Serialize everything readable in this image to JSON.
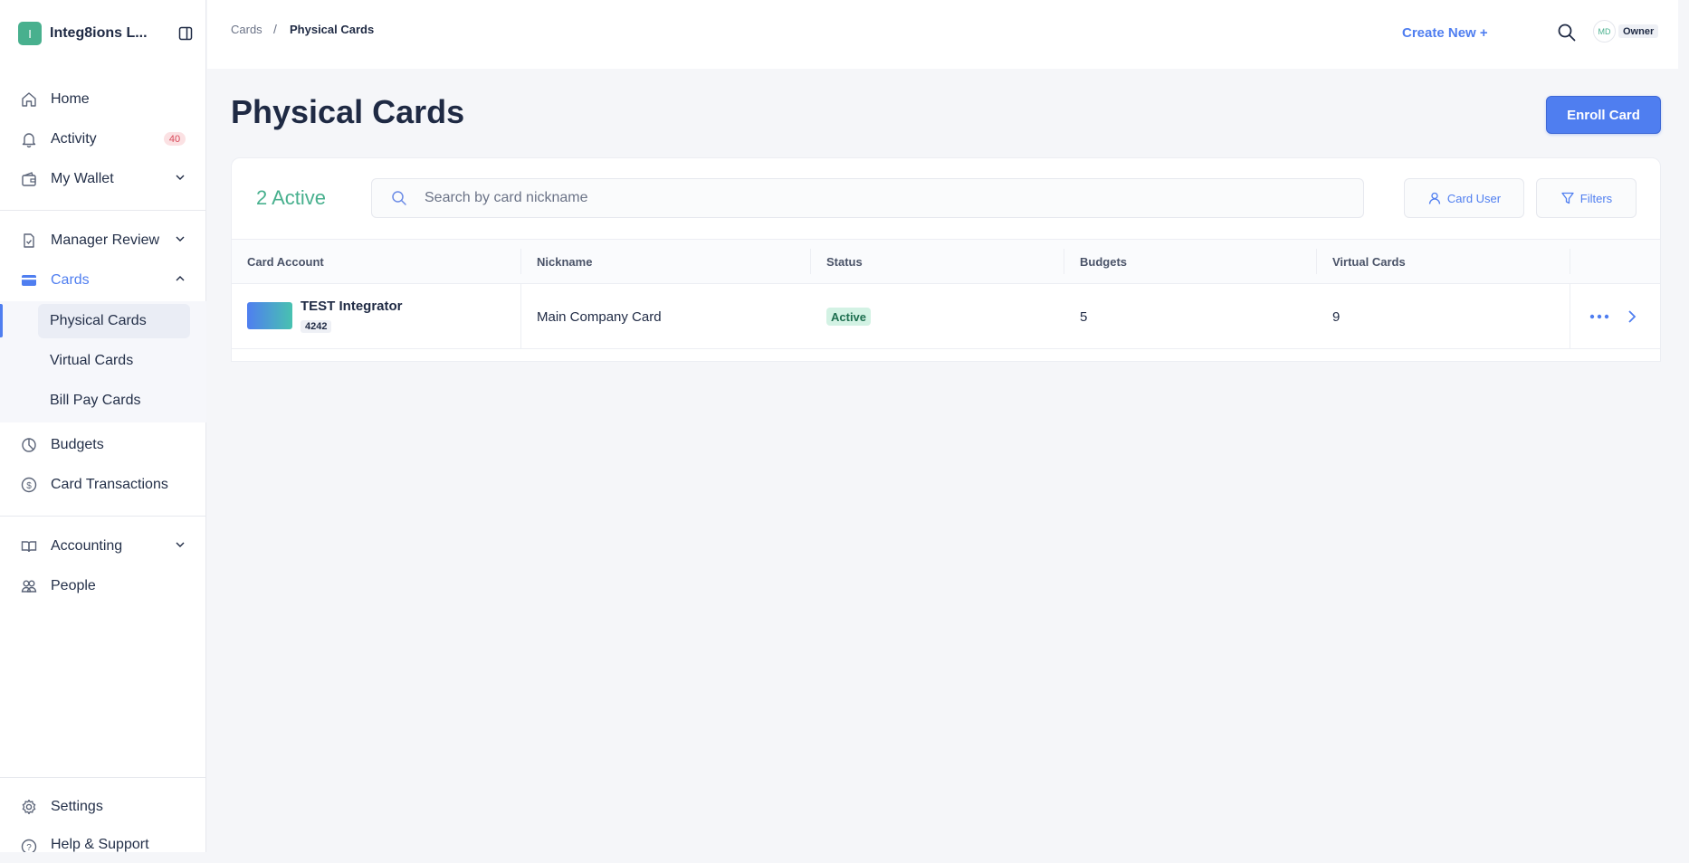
{
  "org": {
    "initial": "I",
    "name": "Integ8ions L..."
  },
  "nav": {
    "home": "Home",
    "activity": "Activity",
    "activity_badge": "40",
    "my_wallet": "My Wallet",
    "manager_review": "Manager Review",
    "cards": "Cards",
    "cards_sub": [
      "Physical Cards",
      "Virtual Cards",
      "Bill Pay Cards"
    ],
    "budgets": "Budgets",
    "card_transactions": "Card Transactions",
    "accounting": "Accounting",
    "people": "People",
    "settings": "Settings",
    "help": "Help & Support"
  },
  "topbar": {
    "breadcrumb": [
      "Cards",
      "Physical Cards"
    ],
    "breadcrumb_sep": "/",
    "create_new": "Create New +",
    "avatar_initials": "MD",
    "role": "Owner"
  },
  "page": {
    "title": "Physical Cards",
    "enroll_button": "Enroll Card",
    "active_count": "2 Active",
    "search_placeholder": "Search by card nickname",
    "card_user_filter": "Card User",
    "filters": "Filters"
  },
  "table": {
    "columns": [
      "Card Account",
      "Nickname",
      "Status",
      "Budgets",
      "Virtual Cards"
    ],
    "rows": [
      {
        "card_name": "TEST Integrator",
        "last4": "4242",
        "nickname": "Main Company Card",
        "status": "Active",
        "budgets": "5",
        "virtual_cards": "9"
      }
    ]
  },
  "colors": {
    "accent": "#4f7ef0",
    "success": "#48b08e",
    "status_bg": "#d3f2e4",
    "badge_bg": "#fbe1e3",
    "badge_text": "#d8495a"
  },
  "icons": {
    "home": "home-icon",
    "activity": "bell-icon",
    "wallet": "wallet-icon",
    "manager_review": "clipboard-check-icon",
    "cards": "credit-card-icon",
    "budgets": "pie-chart-icon",
    "transactions": "dollar-circle-icon",
    "accounting": "book-icon",
    "people": "people-icon",
    "settings": "gear-icon",
    "help": "question-circle-icon"
  }
}
